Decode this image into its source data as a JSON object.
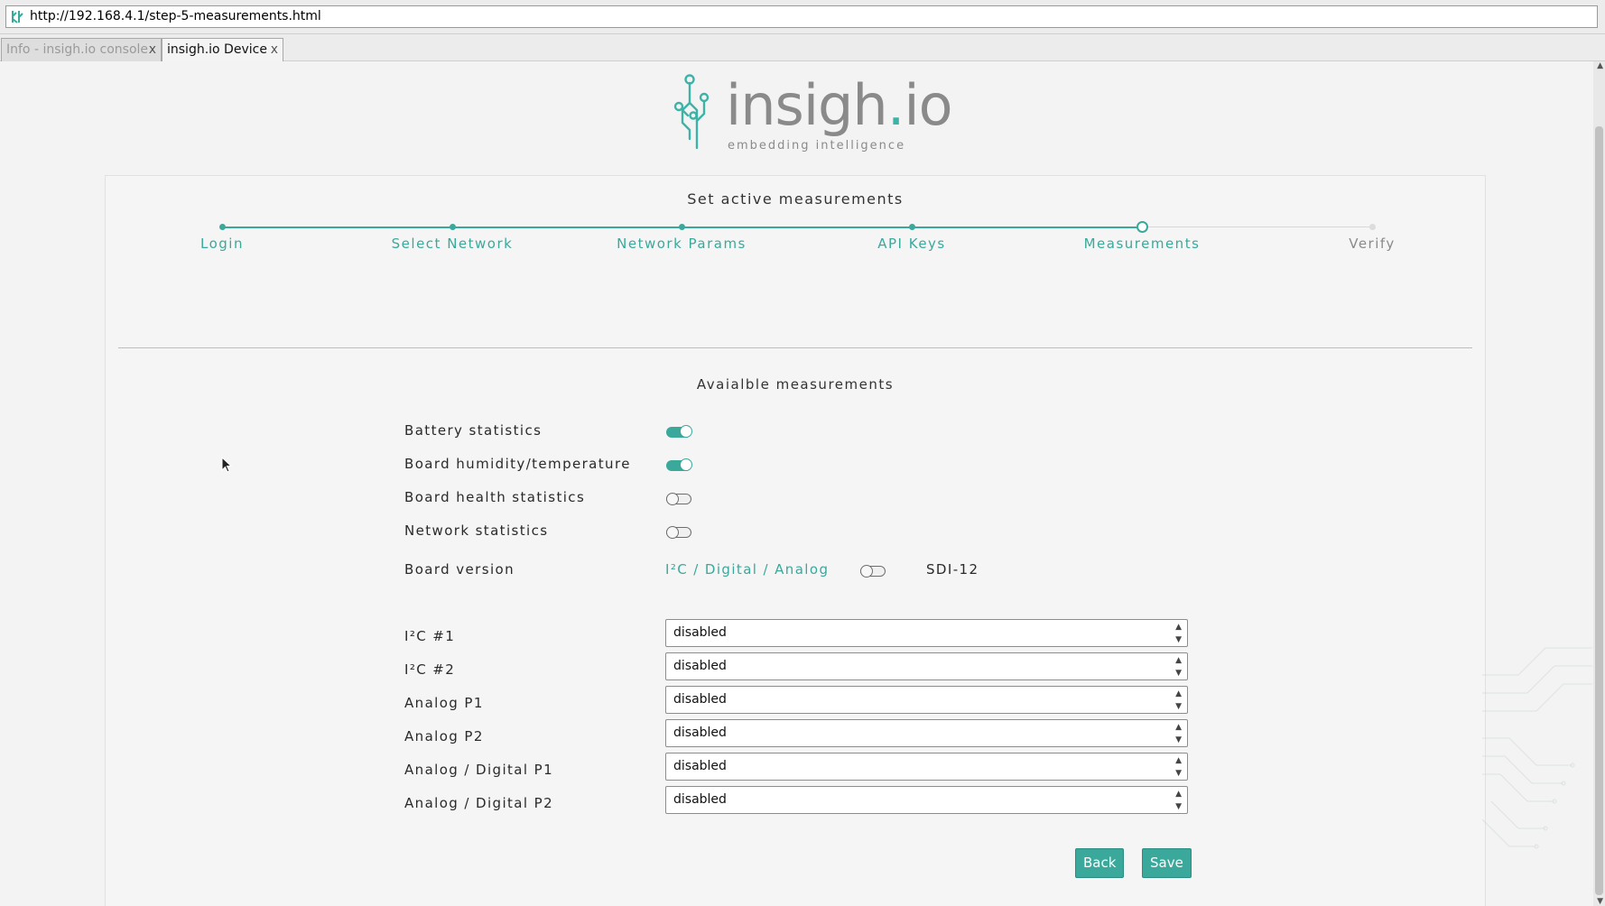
{
  "browser": {
    "url": "http://192.168.4.1/step-5-measurements.html",
    "tabs": [
      {
        "label": "Info - insigh.io console",
        "close": "x",
        "active": false
      },
      {
        "label": "insigh.io Device",
        "close": "x",
        "active": true
      }
    ]
  },
  "logo": {
    "name_main": "insigh",
    "name_dot": ".",
    "name_end": "io",
    "tagline": "embedding intelligence"
  },
  "page": {
    "title": "Set active measurements",
    "steps": [
      {
        "label": "Login",
        "state": "done"
      },
      {
        "label": "Select Network",
        "state": "done"
      },
      {
        "label": "Network Params",
        "state": "done"
      },
      {
        "label": "API Keys",
        "state": "done"
      },
      {
        "label": "Measurements",
        "state": "current"
      },
      {
        "label": "Verify",
        "state": "todo"
      }
    ],
    "section_title": "Avaialble measurements",
    "toggles": [
      {
        "label": "Battery statistics",
        "on": true
      },
      {
        "label": "Board humidity/temperature",
        "on": true
      },
      {
        "label": "Board health statistics",
        "on": false
      },
      {
        "label": "Network statistics",
        "on": false
      }
    ],
    "board_version": {
      "label": "Board version",
      "option_left": "I²C / Digital / Analog",
      "option_right": "SDI-12",
      "on": false
    },
    "selects": [
      {
        "label": "I²C #1",
        "value": "disabled"
      },
      {
        "label": "I²C #2",
        "value": "disabled"
      },
      {
        "label": "Analog P1",
        "value": "disabled"
      },
      {
        "label": "Analog P2",
        "value": "disabled"
      },
      {
        "label": "Analog / Digital P1",
        "value": "disabled"
      },
      {
        "label": "Analog / Digital P2",
        "value": "disabled"
      }
    ],
    "buttons": {
      "back": "Back",
      "save": "Save"
    }
  },
  "colors": {
    "accent": "#3aa99b",
    "text": "#2a2a2a",
    "muted": "#8a8a8a"
  }
}
